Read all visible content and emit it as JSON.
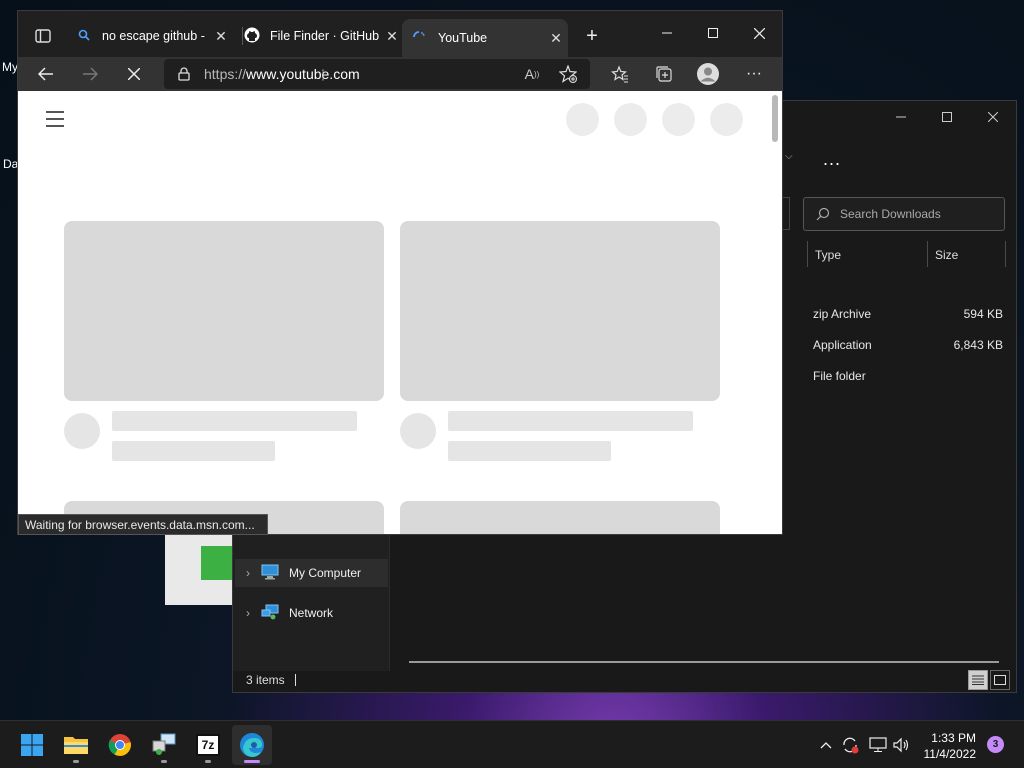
{
  "desktop": {
    "icon_label_partial_1": "My",
    "icon_label_partial_2": "Da"
  },
  "explorer": {
    "search_placeholder": "Search Downloads",
    "columns": {
      "type": "Type",
      "size": "Size"
    },
    "rows": [
      {
        "type": "zip Archive",
        "size": "594 KB"
      },
      {
        "type": "Application",
        "size": "6,843 KB"
      },
      {
        "type": "File folder",
        "size": ""
      }
    ],
    "nav_items": [
      {
        "label": "My Computer",
        "icon": "computer-icon",
        "selected": true
      },
      {
        "label": "Network",
        "icon": "network-icon",
        "selected": false
      }
    ],
    "status": "3 items",
    "more_label": "..."
  },
  "browser": {
    "tabs": [
      {
        "title": "no escape github -",
        "icon": "search-icon",
        "active": false
      },
      {
        "title": "File Finder · GitHub",
        "icon": "github-icon",
        "active": false
      },
      {
        "title": "YouTube",
        "icon": "loading-spinner-icon",
        "active": true
      }
    ],
    "url_prefix": "https://",
    "url_host": "www.youtube.com",
    "status_text": "Waiting for browser.events.data.msn.com..."
  },
  "taskbar": {
    "apps": [
      "windows-start-icon",
      "file-explorer-icon",
      "chrome-icon",
      "network-tool-icon",
      "7zip-icon",
      "edge-icon"
    ],
    "app_7z_label": "7z",
    "time": "1:33 PM",
    "date": "11/4/2022",
    "notification_count": "3"
  },
  "colors": {
    "accent": "#c58af9",
    "browser_dark": "#202020",
    "skeleton": "#d9d9d9"
  }
}
